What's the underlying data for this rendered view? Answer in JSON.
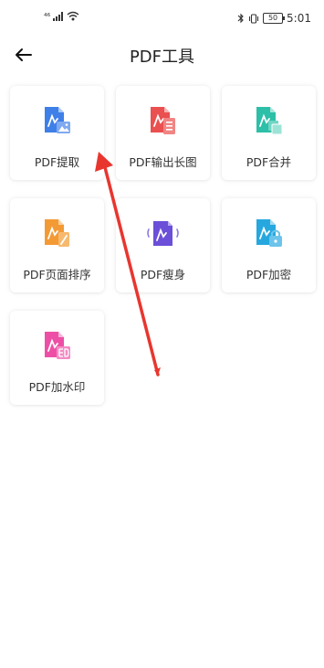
{
  "status_bar": {
    "signal_text": "⁴⁶",
    "battery": "50",
    "time": "5:01"
  },
  "header": {
    "title": "PDF工具"
  },
  "tools": [
    {
      "label": "PDF提取",
      "icon": "pdf-extract-icon",
      "color": "#3F7FE8"
    },
    {
      "label": "PDF输出长图",
      "icon": "pdf-long-image-icon",
      "color": "#E9504F"
    },
    {
      "label": "PDF合并",
      "icon": "pdf-merge-icon",
      "color": "#2DBFA7"
    },
    {
      "label": "PDF页面排序",
      "icon": "pdf-page-sort-icon",
      "color": "#F39A35"
    },
    {
      "label": "PDF瘦身",
      "icon": "pdf-compress-icon",
      "color": "#6B4FD8"
    },
    {
      "label": "PDF加密",
      "icon": "pdf-encrypt-icon",
      "color": "#26A8DF"
    },
    {
      "label": "PDF加水印",
      "icon": "pdf-watermark-icon",
      "color": "#EE4FA6"
    }
  ],
  "annotation": {
    "type": "red-arrow",
    "color": "#E8362F"
  }
}
